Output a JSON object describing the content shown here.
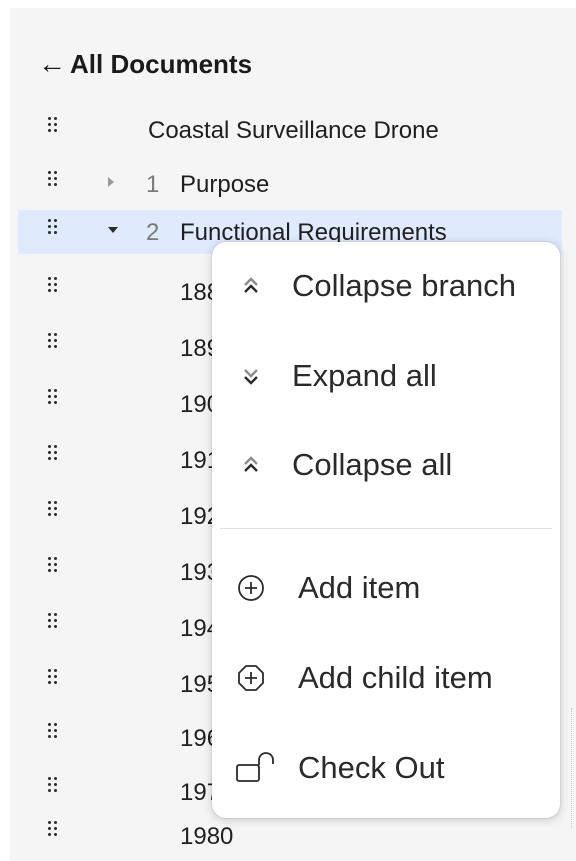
{
  "header": {
    "back_label": "All Documents"
  },
  "tree": {
    "document_title": "Coastal Surveillance Drone",
    "sections": [
      {
        "number": "1",
        "label": "Purpose",
        "expanded": false
      },
      {
        "number": "2",
        "label": "Functional Requirements",
        "expanded": true,
        "selected": true
      }
    ],
    "requirement_ids": [
      "188",
      "189",
      "190",
      "191",
      "192",
      "193",
      "194",
      "195",
      "196",
      "197",
      "1980"
    ]
  },
  "context_menu": {
    "items": [
      {
        "label": "Collapse branch",
        "icon": "double-chevron-up-icon"
      },
      {
        "label": "Expand all",
        "icon": "double-chevron-down-icon"
      },
      {
        "label": "Collapse all",
        "icon": "double-chevron-up-icon"
      },
      {
        "label": "Add item",
        "icon": "plus-circle-icon"
      },
      {
        "label": "Add child item",
        "icon": "plus-octagon-icon"
      },
      {
        "label": "Check Out",
        "icon": "unlocked-lock-icon"
      }
    ]
  },
  "colors": {
    "selected_row": "#dfeafc",
    "panel_bg": "#f5f5f5",
    "menu_bg": "#ffffff"
  }
}
